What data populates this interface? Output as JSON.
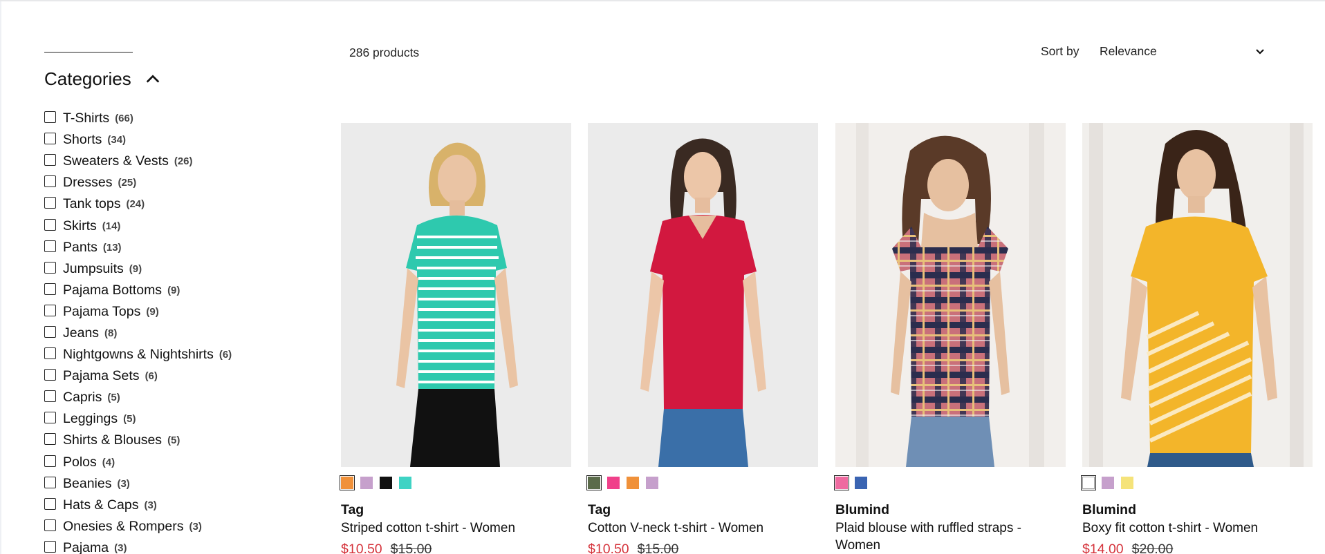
{
  "sidebar": {
    "categories_title": "Categories",
    "categories": [
      {
        "label": "T-Shirts",
        "count": "(66)"
      },
      {
        "label": "Shorts",
        "count": "(34)"
      },
      {
        "label": "Sweaters & Vests",
        "count": "(26)"
      },
      {
        "label": "Dresses",
        "count": "(25)"
      },
      {
        "label": "Tank tops",
        "count": "(24)"
      },
      {
        "label": "Skirts",
        "count": "(14)"
      },
      {
        "label": "Pants",
        "count": "(13)"
      },
      {
        "label": "Jumpsuits",
        "count": "(9)"
      },
      {
        "label": "Pajama Bottoms",
        "count": "(9)"
      },
      {
        "label": "Pajama Tops",
        "count": "(9)"
      },
      {
        "label": "Jeans",
        "count": "(8)"
      },
      {
        "label": "Nightgowns & Nightshirts",
        "count": "(6)"
      },
      {
        "label": "Pajama Sets",
        "count": "(6)"
      },
      {
        "label": "Capris",
        "count": "(5)"
      },
      {
        "label": "Leggings",
        "count": "(5)"
      },
      {
        "label": "Shirts & Blouses",
        "count": "(5)"
      },
      {
        "label": "Polos",
        "count": "(4)"
      },
      {
        "label": "Beanies",
        "count": "(3)"
      },
      {
        "label": "Hats & Caps",
        "count": "(3)"
      },
      {
        "label": "Onesies & Rompers",
        "count": "(3)"
      },
      {
        "label": "Pajama",
        "count": "(3)"
      }
    ]
  },
  "toolbar": {
    "product_count": "286 products",
    "sort_label": "Sort by",
    "sort_value": "Relevance"
  },
  "products": [
    {
      "brand": "Tag",
      "name": "Striped cotton t-shirt - Women",
      "price": "$10.50",
      "old_price": "$15.00",
      "image_icon": "woman-striped-tee-photo",
      "swatches": [
        "#f0913a",
        "#c6a0cc",
        "#111111",
        "#3fd3c4"
      ],
      "selected_swatch": 0
    },
    {
      "brand": "Tag",
      "name": "Cotton V-neck t-shirt - Women",
      "price": "$10.50",
      "old_price": "$15.00",
      "image_icon": "woman-red-vneck-photo",
      "swatches": [
        "#5b6b4a",
        "#f0408a",
        "#f0913a",
        "#c6a0cc"
      ],
      "selected_swatch": 0
    },
    {
      "brand": "Blumind",
      "name": "Plaid blouse with ruffled straps - Women",
      "price": "",
      "old_price": "",
      "image_icon": "woman-plaid-blouse-photo",
      "swatches": [
        "#ef6aa0",
        "#3a64b2"
      ],
      "selected_swatch": 0
    },
    {
      "brand": "Blumind",
      "name": "Boxy fit cotton t-shirt - Women",
      "price": "$14.00",
      "old_price": "$20.00",
      "image_icon": "woman-yellow-striped-tee-photo",
      "swatches": [
        "#ffffff",
        "#c6a0cc",
        "#f5e37a"
      ],
      "selected_swatch": 0
    }
  ],
  "colors": {
    "sale_price": "#d5333b",
    "text": "#111111"
  }
}
